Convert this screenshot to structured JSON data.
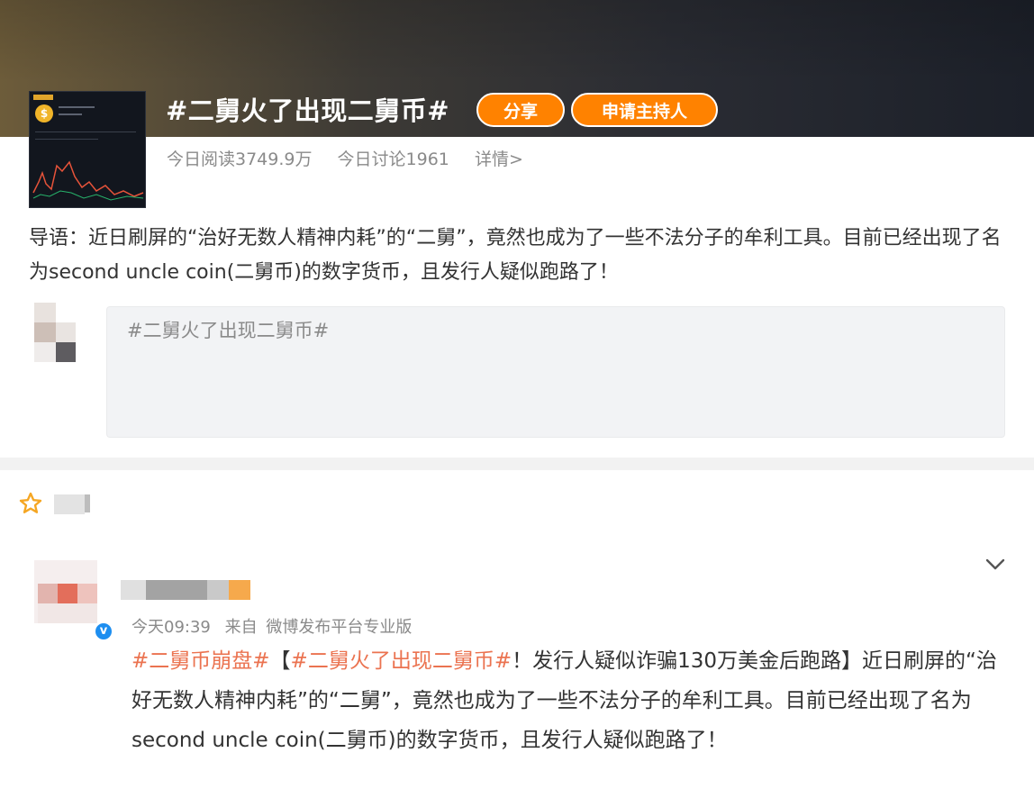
{
  "topic": {
    "title": "#二舅火了出现二舅币#",
    "share_label": "分享",
    "host_label": "申请主持人",
    "reads": "今日阅读3749.9万",
    "discussions": "今日讨论1961",
    "details_label": "详情>",
    "intro": "导语：近日刷屏的“治好无数人精神内耗”的“二舅”，竟然也成为了一些不法分子的牟利工具。目前已经出现了名为second uncle coin(二舅币)的数字货币，且发行人疑似跑路了！"
  },
  "compose": {
    "placeholder": "#二舅火了出现二舅币#"
  },
  "post": {
    "time": "今天09:39",
    "source_prefix": "来自",
    "source": "微博发布平台专业版",
    "tag1": "#二舅币崩盘#",
    "bracket_open": "【",
    "tag2": "#二舅火了出现二舅币#",
    "headline": "！发行人疑似诈骗130万美金后跑路】",
    "body": "近日刷屏的“治好无数人精神内耗”的“二舅”，竟然也成为了一些不法分子的牟利工具。目前已经出现了名为second uncle coin(二舅币)的数字货币，且发行人疑似跑路了！"
  },
  "icons": {
    "favorite": "star-outline-icon",
    "verified": "verified-badge-icon",
    "expand": "chevron-down-icon"
  },
  "colors": {
    "accent": "#ff8200",
    "hashtag": "#eb7350",
    "verified": "#1d8ef0",
    "muted": "#8a8a8a"
  }
}
